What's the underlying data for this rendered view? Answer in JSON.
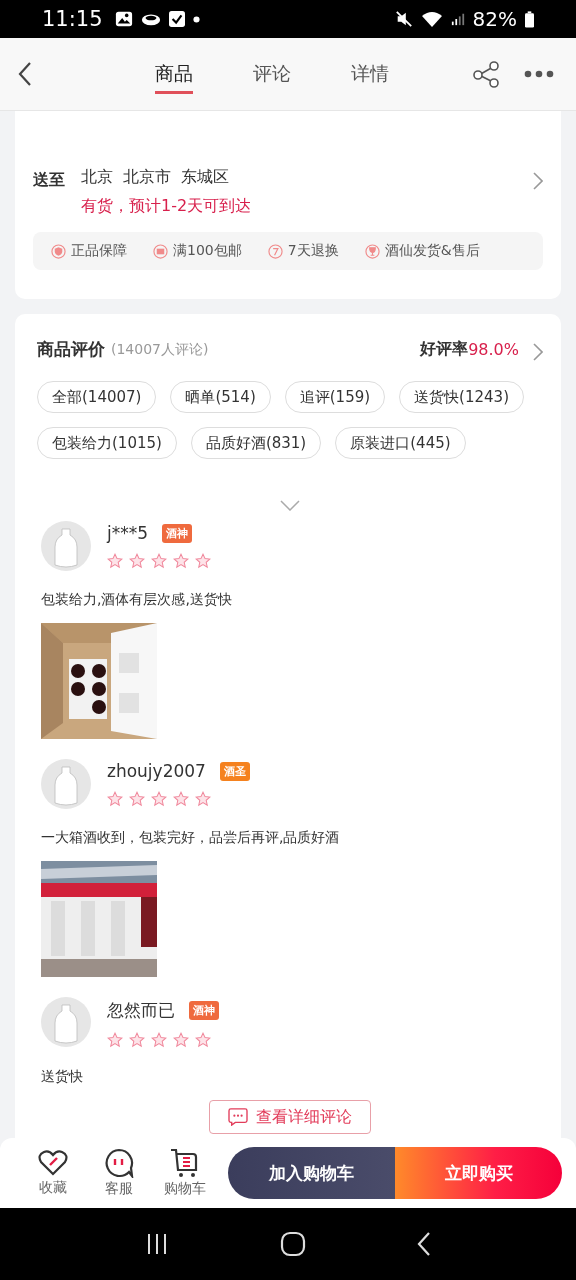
{
  "status_bar": {
    "time": "11:15",
    "battery": "82%"
  },
  "header": {
    "tabs": [
      {
        "label": "商品",
        "selected": true
      },
      {
        "label": "评论",
        "selected": false
      },
      {
        "label": "详情",
        "selected": false
      }
    ]
  },
  "delivery": {
    "label": "送至",
    "address": [
      "北京",
      "北京市",
      "东城区"
    ],
    "stock": "有货，预计1-2天可到达",
    "guarantees": [
      {
        "kind": "shield",
        "label": "正品保障"
      },
      {
        "kind": "mail",
        "label": "满100包邮"
      },
      {
        "kind": "return",
        "label": "7天退换"
      },
      {
        "kind": "ship",
        "label": "酒仙发货&售后"
      }
    ]
  },
  "reviews_section": {
    "title": "商品评价",
    "count": "(14007人评论)",
    "rate_label": "好评率",
    "rate": "98.0%",
    "tags": [
      {
        "label": "全部(14007)"
      },
      {
        "label": "晒单(514)"
      },
      {
        "label": "追评(159)"
      },
      {
        "label": "送货快(1243)"
      },
      {
        "label": "包装给力(1015)"
      },
      {
        "label": "品质好酒(831)"
      },
      {
        "label": "原装进口(445)"
      }
    ],
    "reviews": [
      {
        "user": "j***5",
        "badge": "酒神",
        "color": "#ef6a3e",
        "stars": 5,
        "text": "包装给力,酒体有层次感,送货快"
      },
      {
        "user": "zhoujy2007",
        "badge": "酒圣",
        "color": "#f5821f",
        "stars": 5,
        "text": "一大箱酒收到，包装完好，品尝后再评,品质好酒"
      },
      {
        "user": "忽然而已",
        "badge": "酒神",
        "color": "#ef6a3e",
        "stars": 5,
        "text": "送货快"
      }
    ],
    "more_button": "查看详细评论"
  },
  "bottom_bar": {
    "actions": [
      {
        "kind": "favorite",
        "label": "收藏"
      },
      {
        "kind": "service",
        "label": "客服"
      },
      {
        "kind": "cart",
        "label": "购物车"
      }
    ],
    "add_to_cart": "加入购物车",
    "buy_now": "立即购买"
  }
}
